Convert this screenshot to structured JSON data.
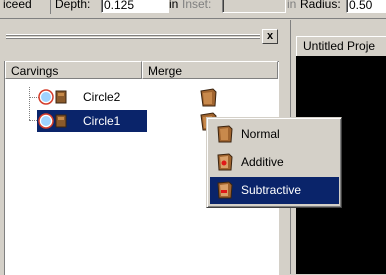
{
  "toolbar": {
    "fragment_left": "iceed",
    "depth_label": "Depth:",
    "depth_value": "0.125",
    "unit1": "in",
    "inset_label": "Inset:",
    "unit2": "in",
    "radius_label": "Radius:",
    "radius_value": "0.50"
  },
  "panel": {
    "close_label": "x",
    "columns": [
      "Carvings",
      "Merge"
    ],
    "items": [
      {
        "label": "Circle2",
        "selected": false,
        "merge_icon": "material-swatch-icon"
      },
      {
        "label": "Circle1",
        "selected": true,
        "merge_icon": "material-swatch-icon"
      }
    ]
  },
  "viewport": {
    "tab_label": "Untitled Proje"
  },
  "context_menu": {
    "items": [
      {
        "label": "Normal",
        "icon": "merge-normal-icon",
        "highlighted": false
      },
      {
        "label": "Additive",
        "icon": "merge-additive-icon",
        "highlighted": false
      },
      {
        "label": "Subtractive",
        "icon": "merge-subtractive-icon",
        "highlighted": true
      }
    ]
  },
  "colors": {
    "chrome": "#d4d0c8",
    "selection": "#0a246a",
    "viewport_bg": "#000000"
  }
}
